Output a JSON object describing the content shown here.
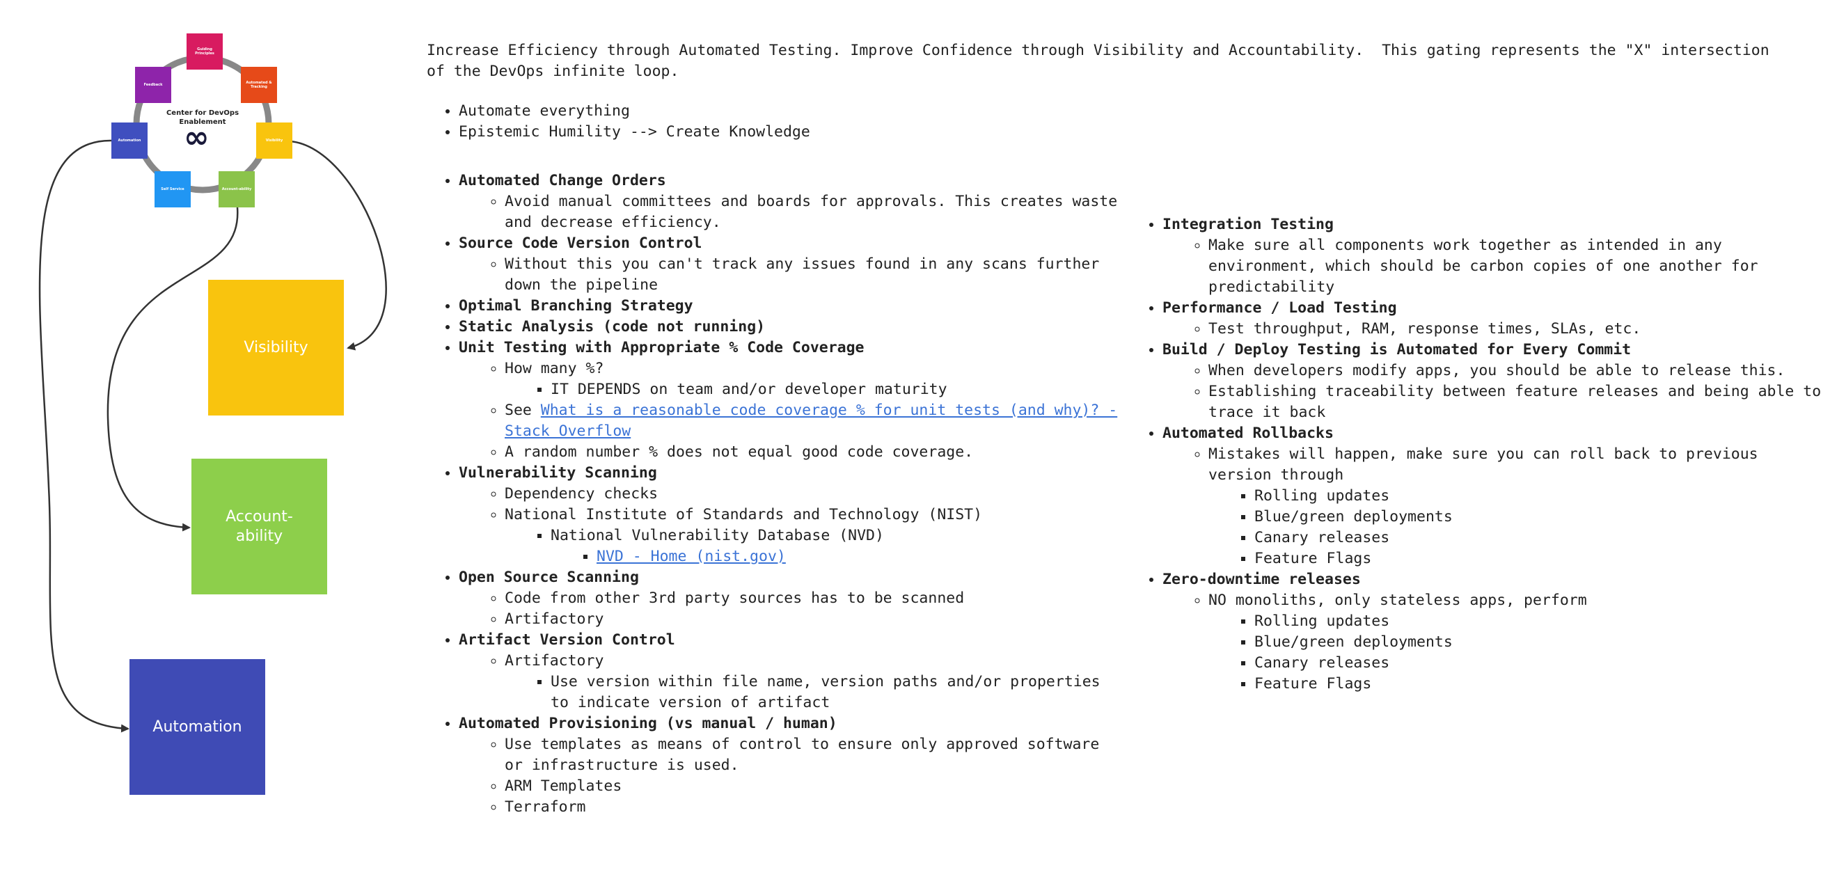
{
  "wheel": {
    "center_title": "Center for DevOps Enablement",
    "infinity": "∞",
    "tiles": [
      {
        "label": "Guiding Principles",
        "color": "#d81b60"
      },
      {
        "label": "Automated & Tracking",
        "color": "#e64a19"
      },
      {
        "label": "Visibility",
        "color": "#f9c40e"
      },
      {
        "label": "Account-ability",
        "color": "#8bc34a"
      },
      {
        "label": "Self Service",
        "color": "#2196f3"
      },
      {
        "label": "Automation",
        "color": "#3f4fbf"
      },
      {
        "label": "Feedback",
        "color": "#8e24aa"
      }
    ]
  },
  "boxes": {
    "visibility": {
      "label": "Visibility",
      "color": "#f9c40e"
    },
    "accountability": {
      "label": "Account-\nability",
      "color": "#8dcf4b"
    },
    "automation": {
      "label": "Automation",
      "color": "#3f4bb5"
    }
  },
  "intro": "Increase Efficiency through Automated Testing. Improve Confidence through Visibility and Accountability.  This gating represents the \"X\" intersection of the DevOps infinite loop.",
  "principles": [
    "Automate everything",
    "Epistemic Humility --> Create Knowledge"
  ],
  "left_list": [
    {
      "title": "Automated Change Orders",
      "items": [
        "Avoid manual committees and boards for approvals. This creates waste and decrease efficiency."
      ]
    },
    {
      "title": "Source Code Version Control",
      "items": [
        "Without this you can't track any issues found in any scans further down the pipeline"
      ]
    },
    {
      "title": "Optimal Branching Strategy"
    },
    {
      "title": "Static Analysis (code not running)"
    },
    {
      "title": "Unit Testing with Appropriate % Code Coverage",
      "how_many": "How many %?",
      "it_depends": "IT DEPENDS on team and/or developer maturity",
      "see": "See ",
      "link": "What is a reasonable code coverage % for unit tests (and why)? - Stack Overflow",
      "random": "A random number % does not equal good code coverage."
    },
    {
      "title": "Vulnerability Scanning",
      "dep": "Dependency checks",
      "nist": "National Institute of Standards and Technology (NIST)",
      "nvd": "National Vulnerability Database (NVD)",
      "nvd_link": "NVD - Home (nist.gov)"
    },
    {
      "title": "Open Source Scanning",
      "items": [
        "Code from other 3rd party sources has to be scanned",
        "Artifactory"
      ]
    },
    {
      "title": "Artifact Version Control",
      "artifactory": "Artifactory",
      "use_version": "Use version within file name, version paths and/or properties to indicate version of artifact"
    },
    {
      "title": "Automated Provisioning (vs manual / human)",
      "items": [
        "Use templates as means of control to ensure only approved software or infrastructure is used.",
        "ARM Templates",
        "Terraform"
      ]
    }
  ],
  "right_list": [
    {
      "title": "Integration Testing",
      "items": [
        "Make sure all components work together as intended in any environment, which should be carbon copies of one another for predictability"
      ]
    },
    {
      "title": "Performance / Load Testing",
      "items": [
        "Test throughput, RAM, response times, SLAs, etc."
      ]
    },
    {
      "title": "Build / Deploy Testing is Automated for Every Commit",
      "items": [
        "When developers modify apps, you should be able to release this.",
        "Establishing traceability between feature releases and being able to trace it back"
      ]
    },
    {
      "title": "Automated Rollbacks",
      "lead": "Mistakes will happen, make sure you can roll back to previous version through",
      "subs": [
        "Rolling updates",
        "Blue/green deployments",
        "Canary releases",
        "Feature Flags"
      ]
    },
    {
      "title": "Zero-downtime releases",
      "lead": "NO monoliths, only stateless apps, perform",
      "subs": [
        "Rolling updates",
        "Blue/green deployments",
        "Canary releases",
        "Feature Flags"
      ]
    }
  ]
}
